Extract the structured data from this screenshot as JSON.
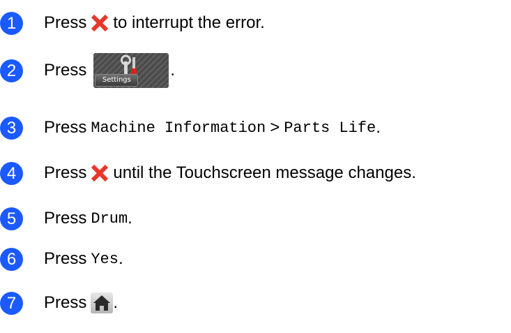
{
  "steps": [
    {
      "number": "1",
      "press": "Press",
      "text": "to interrupt the error."
    },
    {
      "number": "2",
      "press": "Press",
      "end": ".",
      "settings_label": "Settings"
    },
    {
      "number": "3",
      "press": "Press",
      "item1": "Machine Information",
      "sep": ">",
      "item2": "Parts Life",
      "end": "."
    },
    {
      "number": "4",
      "press": "Press",
      "text": "until the Touchscreen message changes."
    },
    {
      "number": "5",
      "press": "Press",
      "item": "Drum",
      "end": "."
    },
    {
      "number": "6",
      "press": "Press",
      "item": "Yes",
      "end": "."
    },
    {
      "number": "7",
      "press": "Press",
      "end": "."
    }
  ],
  "icons": {
    "close": "close-x-icon",
    "settings": "settings-tools-icon",
    "home": "home-icon"
  },
  "colors": {
    "step_circle": "#1a5aff",
    "close_x": "#e8372a"
  }
}
